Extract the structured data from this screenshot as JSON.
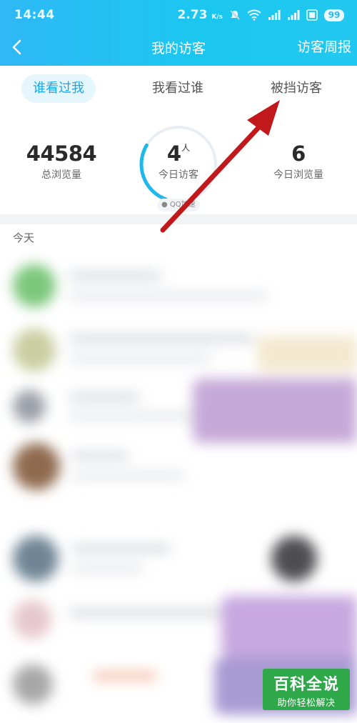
{
  "status_bar": {
    "time": "14:44",
    "speed": "2.73",
    "speed_unit": "K/s",
    "battery": "99",
    "icons": [
      "mute-icon",
      "wifi-icon",
      "signal-icon",
      "signal-icon",
      "hd-icon",
      "battery-icon"
    ]
  },
  "nav": {
    "title": "我的访客",
    "right_label": "访客周报"
  },
  "tabs": [
    {
      "label": "谁看过我",
      "active": true
    },
    {
      "label": "我看过谁",
      "active": false
    },
    {
      "label": "被挡访客",
      "active": false
    }
  ],
  "stats": {
    "total_views": {
      "value": "44584",
      "label": "总浏览量"
    },
    "today_visitors": {
      "value": "4",
      "unit": "人",
      "label": "今日访客",
      "badge": "QQ加速",
      "ring_progress": 0.28
    },
    "today_views": {
      "value": "6",
      "label": "今日浏览量"
    }
  },
  "list": {
    "section_label": "今天"
  },
  "colors": {
    "header_start": "#2fb8f5",
    "header_end": "#22c8f0",
    "accent": "#16a9ea",
    "arrow": "#c0181b",
    "watermark_bg": "#2fa84a"
  },
  "watermark": {
    "main": "百科全说",
    "sub": "助你轻松解决"
  }
}
